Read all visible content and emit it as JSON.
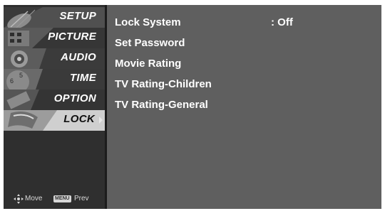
{
  "menu": {
    "items": [
      {
        "label": "SETUP",
        "icon": "satellite-dish-icon"
      },
      {
        "label": "PICTURE",
        "icon": "film-reel-icon"
      },
      {
        "label": "AUDIO",
        "icon": "speaker-icon"
      },
      {
        "label": "TIME",
        "icon": "clock-icon"
      },
      {
        "label": "OPTION",
        "icon": "option-tag-icon"
      },
      {
        "label": "LOCK",
        "icon": "lock-icon"
      }
    ],
    "active_index": 5
  },
  "footer": {
    "move_label": "Move",
    "menu_key": "MENU",
    "prev_label": "Prev"
  },
  "lock_menu": {
    "options": [
      {
        "label": "Lock System",
        "value": ": Off"
      },
      {
        "label": "Set Password"
      },
      {
        "label": "Movie Rating"
      },
      {
        "label": "TV Rating-Children"
      },
      {
        "label": "TV Rating-General"
      }
    ]
  },
  "colors": {
    "panel_bg": "#5f5f5f",
    "sidebar_bg": "#2f2f2f",
    "active_item_bg": "#cfcfcf",
    "text": "#ffffff"
  }
}
